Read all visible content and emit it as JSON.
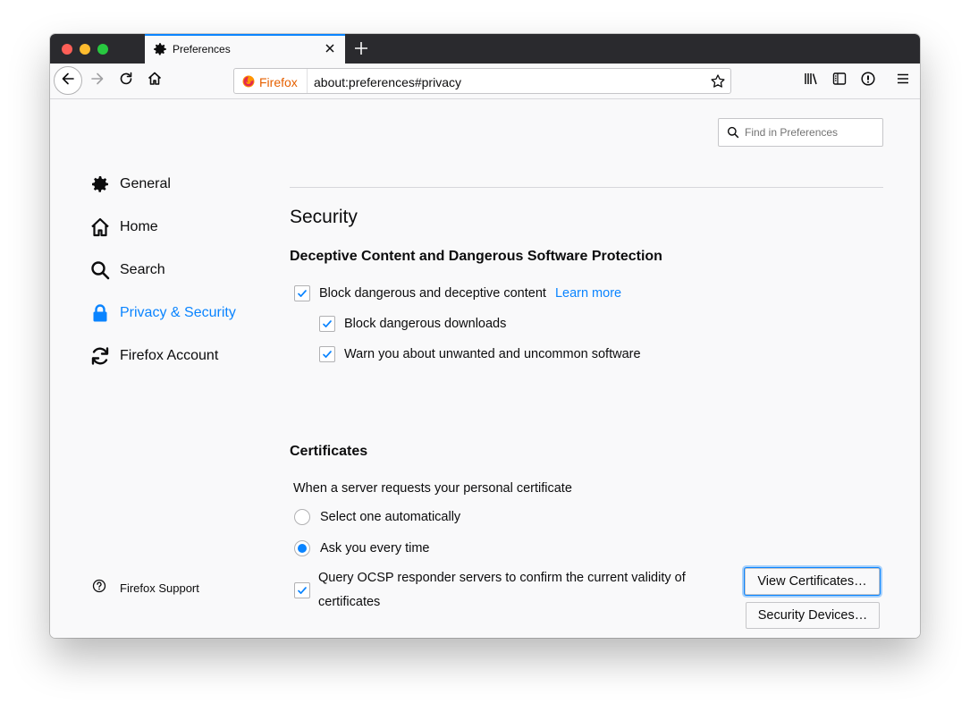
{
  "tab": {
    "title": "Preferences"
  },
  "urlbar": {
    "brand": "Firefox",
    "url": "about:preferences#privacy"
  },
  "search": {
    "placeholder": "Find in Preferences"
  },
  "sidebar": {
    "items": [
      {
        "label": "General",
        "icon": "gear-icon"
      },
      {
        "label": "Home",
        "icon": "home-icon"
      },
      {
        "label": "Search",
        "icon": "search-icon"
      },
      {
        "label": "Privacy & Security",
        "icon": "lock-icon",
        "selected": true
      },
      {
        "label": "Firefox Account",
        "icon": "sync-icon"
      }
    ],
    "support": "Firefox Support"
  },
  "security": {
    "heading": "Security",
    "deceptive": {
      "heading": "Deceptive Content and Dangerous Software Protection",
      "block_content": {
        "label": "Block dangerous and deceptive content",
        "checked": true
      },
      "learn_more": "Learn more",
      "block_downloads": {
        "label": "Block dangerous downloads",
        "checked": true
      },
      "warn_unwanted": {
        "label": "Warn you about unwanted and uncommon software",
        "checked": true
      }
    },
    "certificates": {
      "heading": "Certificates",
      "prompt": "When a server requests your personal certificate",
      "option_auto": {
        "label": "Select one automatically",
        "selected": false
      },
      "option_ask": {
        "label": "Ask you every time",
        "selected": true
      },
      "ocsp": {
        "line1": "Query OCSP responder servers to confirm the current validity of",
        "line2": "certificates",
        "checked": true
      },
      "view_button": "View Certificates…",
      "devices_button": "Security Devices…"
    }
  },
  "colors": {
    "accent": "#0a84ff",
    "tabstrip": "#2a2a2e",
    "brand": "#e66000"
  }
}
